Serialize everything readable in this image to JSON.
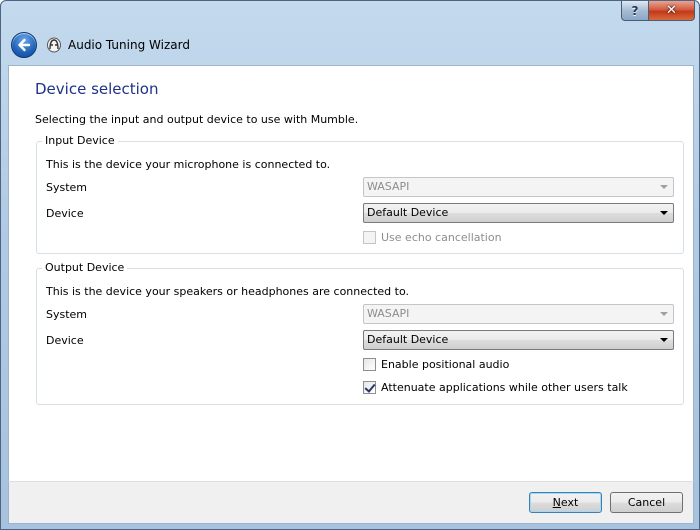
{
  "window": {
    "title": "Audio Tuning Wizard",
    "help_glyph": "?",
    "close_glyph": "✕",
    "back_icon": "back-arrow-icon",
    "app_icon": "mumble-icon"
  },
  "page": {
    "title": "Device selection",
    "subtitle": "Selecting the input and output device to use with Mumble."
  },
  "input_device": {
    "group_label": "Input Device",
    "description": "This is the device your microphone is connected to.",
    "system_label": "System",
    "system_value": "WASAPI",
    "system_enabled": false,
    "device_label": "Device",
    "device_value": "Default Device",
    "echo_label": "Use echo cancellation",
    "echo_checked": false,
    "echo_enabled": false
  },
  "output_device": {
    "group_label": "Output Device",
    "description": "This is the device your speakers or headphones are connected to.",
    "system_label": "System",
    "system_value": "WASAPI",
    "system_enabled": false,
    "device_label": "Device",
    "device_value": "Default Device",
    "positional_label": "Enable positional audio",
    "positional_checked": false,
    "attenuate_label": "Attenuate applications while other users talk",
    "attenuate_checked": true
  },
  "footer": {
    "next_label": "Next",
    "cancel_label": "Cancel"
  },
  "colors": {
    "title_blue": "#1e3287",
    "frame": "#b2cbe4"
  }
}
